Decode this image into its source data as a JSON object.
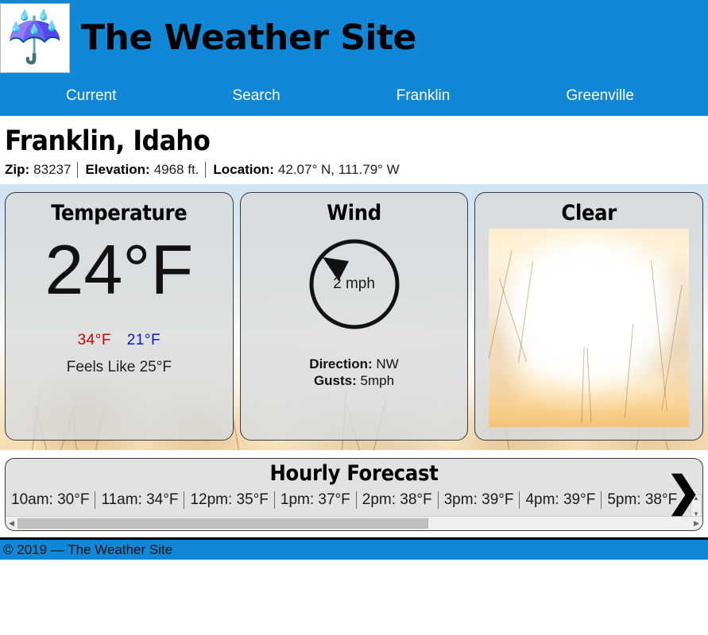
{
  "header": {
    "logo_icon": "umbrella-with-rain-icon",
    "logo_glyph": "☔",
    "title": "The Weather Site",
    "bar_color": "#1187d7"
  },
  "nav": {
    "items": [
      {
        "label": "Current"
      },
      {
        "label": "Search"
      },
      {
        "label": "Franklin"
      },
      {
        "label": "Greenville"
      }
    ]
  },
  "location": {
    "title": "Franklin, Idaho",
    "meta": [
      {
        "label": "Zip:",
        "value": "83237"
      },
      {
        "label": "Elevation:",
        "value": "4968 ft."
      },
      {
        "label": "Location:",
        "value": "42.07° N, 111.79° W"
      }
    ]
  },
  "cards": {
    "temperature": {
      "title": "Temperature",
      "current": "24°F",
      "high": "34°F",
      "low": "21°F",
      "feels_like": "Feels Like 25°F",
      "high_color": "#cc0000",
      "low_color": "#1414cc"
    },
    "wind": {
      "title": "Wind",
      "speed": "2 mph",
      "direction_label": "Direction:",
      "direction_value": "NW",
      "gusts_label": "Gusts:",
      "gusts_value": "5mph",
      "dial_icon": "wind-direction-dial-icon"
    },
    "conditions": {
      "title": "Clear",
      "image_icon": "clear-sky-photo"
    }
  },
  "hourly": {
    "title": "Hourly Forecast",
    "entries": [
      {
        "time": "10am",
        "temp": "30°F",
        "text": "10am: 30°F"
      },
      {
        "time": "11am",
        "temp": "34°F",
        "text": "11am: 34°F"
      },
      {
        "time": "12pm",
        "temp": "35°F",
        "text": "12pm: 35°F"
      },
      {
        "time": "1pm",
        "temp": "37°F",
        "text": "1pm: 37°F"
      },
      {
        "time": "2pm",
        "temp": "38°F",
        "text": "2pm: 38°F"
      },
      {
        "time": "3pm",
        "temp": "39°F",
        "text": "3pm: 39°F"
      },
      {
        "time": "4pm",
        "temp": "39°F",
        "text": "4pm: 39°F"
      },
      {
        "time": "5pm",
        "temp": "38°F",
        "text": "5pm: 38°F"
      }
    ],
    "next_arrow": "❯",
    "scroll_left_arrow": "◀",
    "scroll_right_arrow": "▶",
    "scroll_up_arrow": "▲",
    "scroll_down_arrow": "▼"
  },
  "footer": {
    "text": "© 2019 — The Weather Site"
  }
}
